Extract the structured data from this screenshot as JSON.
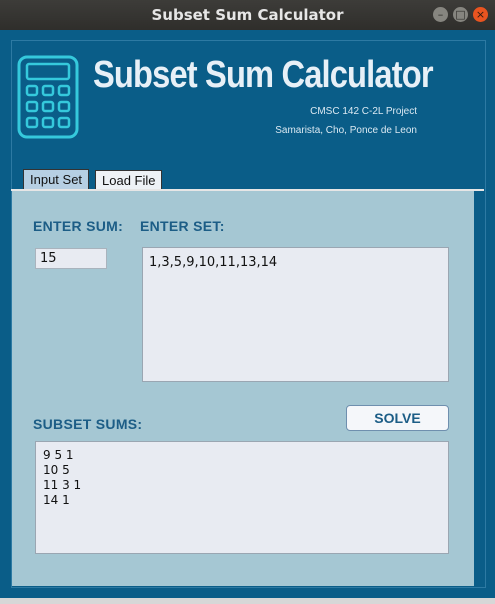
{
  "window": {
    "title": "Subset Sum Calculator",
    "controls": [
      "minimize",
      "maximize",
      "close"
    ]
  },
  "header": {
    "title": "Subset Sum Calculator",
    "project": "CMSC 142 C-2L Project",
    "authors": "Samarista, Cho, Ponce de Leon",
    "icon": "calculator-icon"
  },
  "tabs": [
    {
      "label": "Input Set",
      "active": true
    },
    {
      "label": "Load File",
      "active": false
    }
  ],
  "form": {
    "sum_label": "ENTER SUM:",
    "sum_value": "15",
    "set_label": "ENTER SET:",
    "set_value": "1,3,5,9,10,11,13,14",
    "solve_label": "SOLVE"
  },
  "results": {
    "label": "SUBSET SUMS:",
    "lines": [
      "9 5 1",
      "10 5",
      "11 3 1",
      "14 1"
    ]
  },
  "colors": {
    "frame": "#0a5d88",
    "panel": "#a5c7d3",
    "accent_text": "#1c5d86",
    "icon": "#35c9dc",
    "close_button": "#e95420"
  }
}
